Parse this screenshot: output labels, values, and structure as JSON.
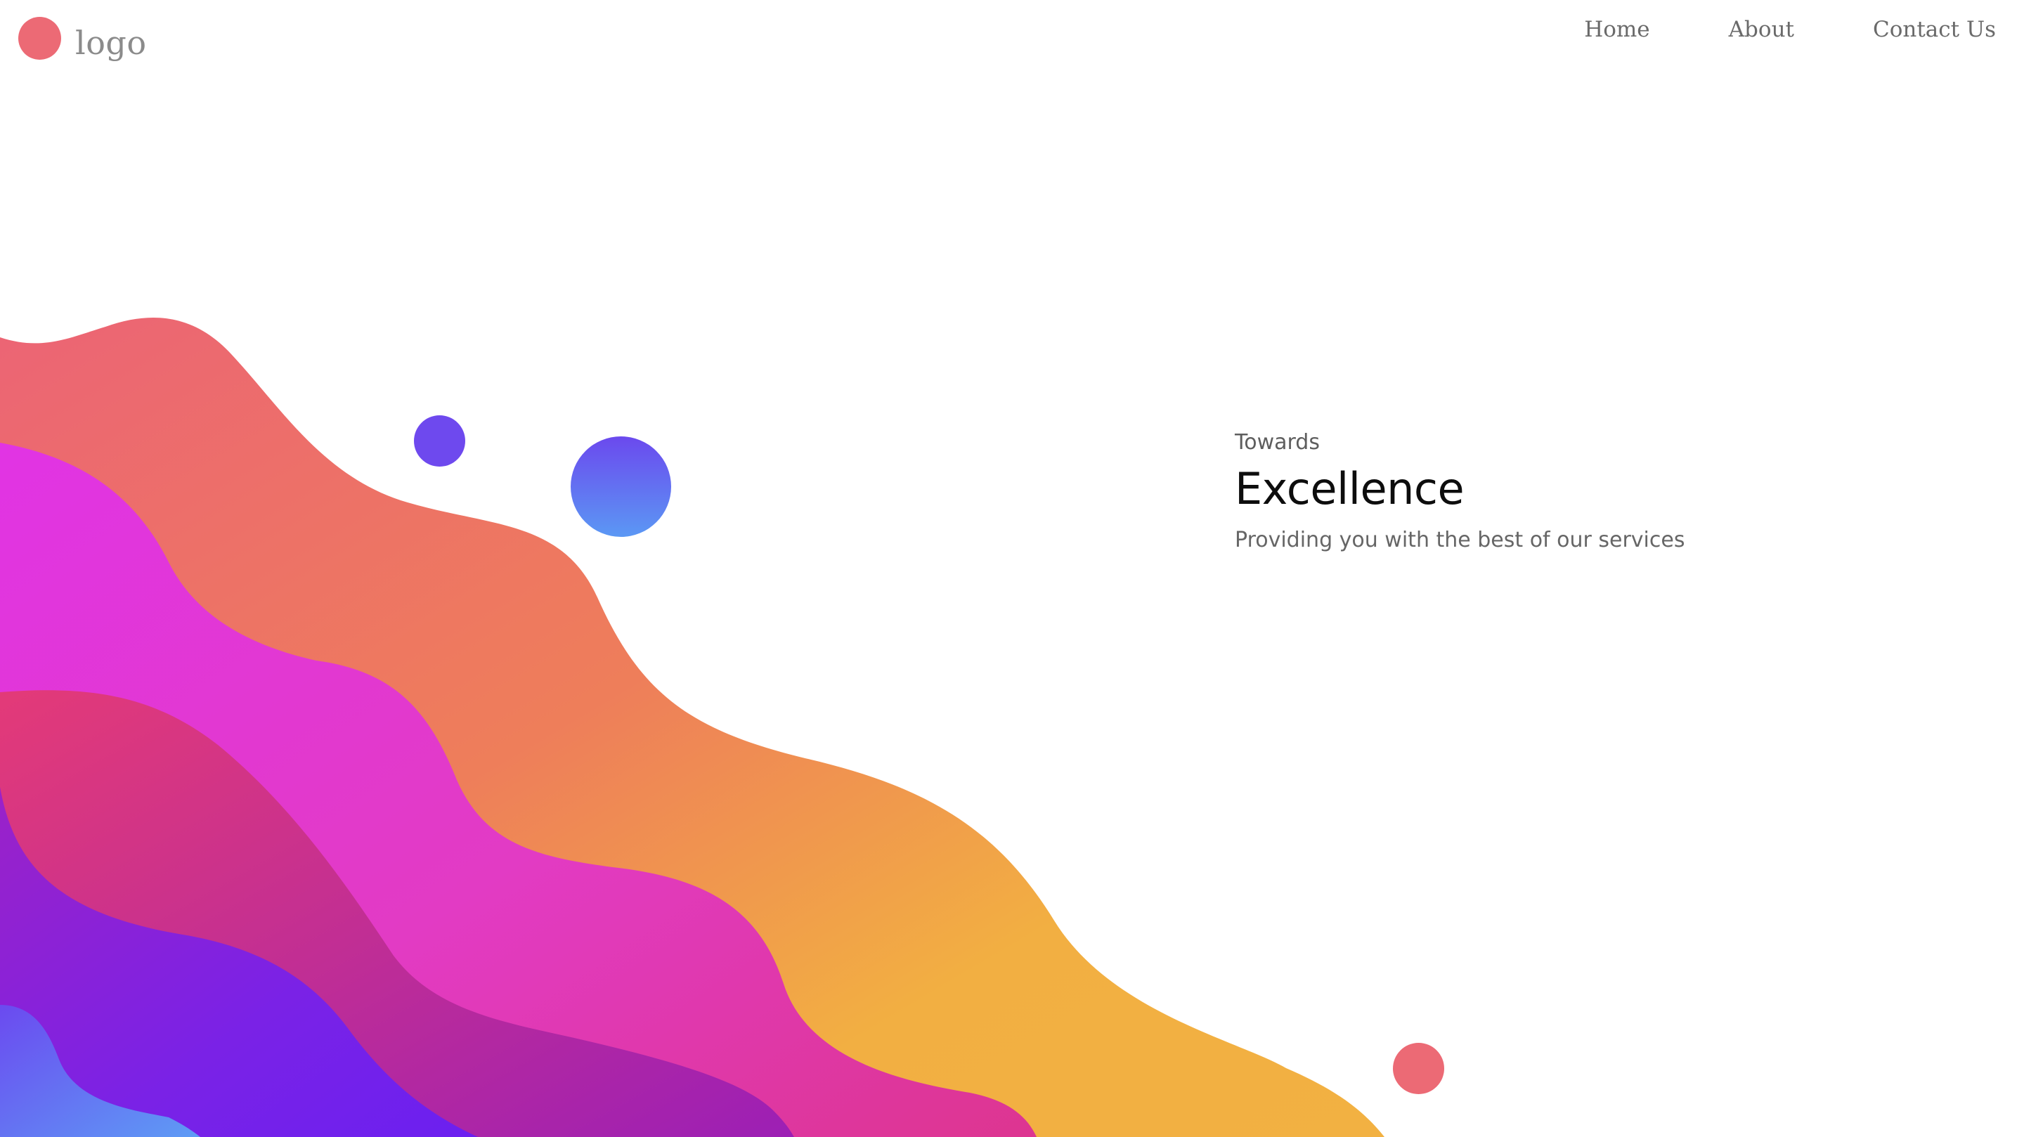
{
  "header": {
    "logo_text": "logo",
    "nav": [
      {
        "label": "Home"
      },
      {
        "label": "About"
      },
      {
        "label": "Contact Us"
      }
    ]
  },
  "hero": {
    "eyebrow": "Towards",
    "title": "Excellence",
    "subtitle": "Providing you with the best of our services"
  },
  "colors": {
    "accent_coral": "#EC6A75",
    "accent_purple": "#6E49EE",
    "accent_blue": "#5B98F4",
    "wave_orange": "#F2B142",
    "wave_magenta": "#E23BD7"
  }
}
